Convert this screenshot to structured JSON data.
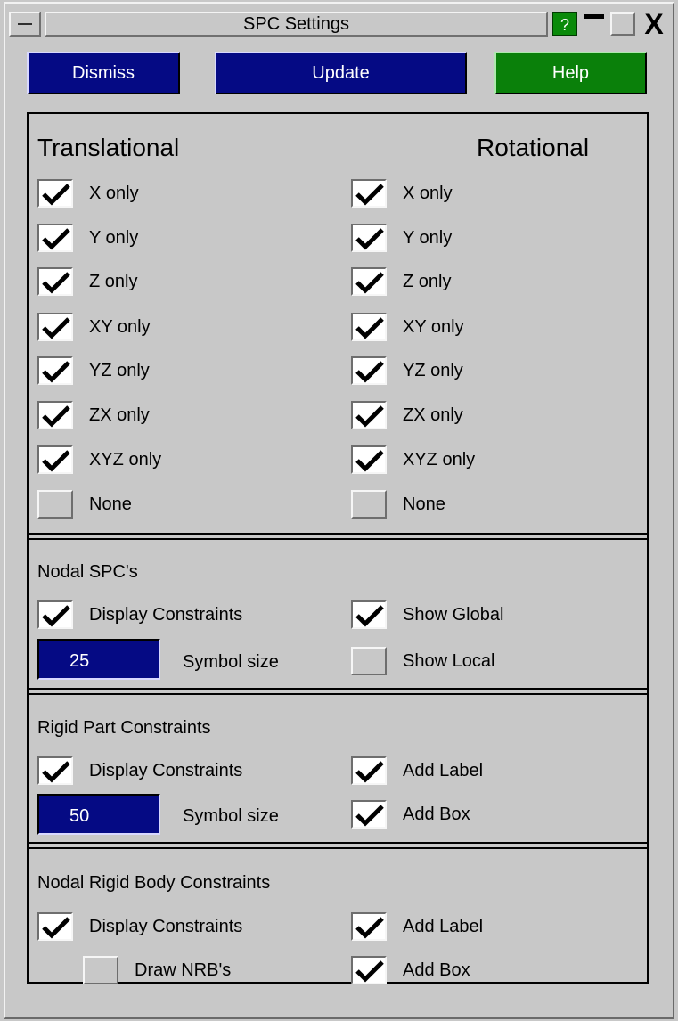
{
  "window": {
    "title": "SPC Settings",
    "help_glyph": "?",
    "close_glyph": "X"
  },
  "toolbar": {
    "dismiss_label": "Dismiss",
    "update_label": "Update",
    "help_label": "Help"
  },
  "colors": {
    "button_blue": "#050a84",
    "button_green": "#0a800a",
    "background": "#c8c8c8"
  },
  "dof": {
    "translational_heading": "Translational",
    "rotational_heading": "Rotational",
    "translational": [
      {
        "label": "X only",
        "checked": true
      },
      {
        "label": "Y only",
        "checked": true
      },
      {
        "label": "Z only",
        "checked": true
      },
      {
        "label": "XY only",
        "checked": true
      },
      {
        "label": "YZ only",
        "checked": true
      },
      {
        "label": "ZX only",
        "checked": true
      },
      {
        "label": "XYZ only",
        "checked": true
      },
      {
        "label": "None",
        "checked": false
      }
    ],
    "rotational": [
      {
        "label": "X only",
        "checked": true
      },
      {
        "label": "Y only",
        "checked": true
      },
      {
        "label": "Z only",
        "checked": true
      },
      {
        "label": "XY only",
        "checked": true
      },
      {
        "label": "YZ only",
        "checked": true
      },
      {
        "label": "ZX only",
        "checked": true
      },
      {
        "label": "XYZ only",
        "checked": true
      },
      {
        "label": "None",
        "checked": false
      }
    ]
  },
  "nodal_spc": {
    "title": "Nodal SPC's",
    "display_constraints": {
      "label": "Display Constraints",
      "checked": true
    },
    "show_global": {
      "label": "Show Global",
      "checked": true
    },
    "symbol_size_value": "25",
    "symbol_size_label": "Symbol size",
    "show_local": {
      "label": "Show Local",
      "checked": false
    }
  },
  "rigid_part": {
    "title": "Rigid Part Constraints",
    "display_constraints": {
      "label": "Display Constraints",
      "checked": true
    },
    "add_label": {
      "label": "Add Label",
      "checked": true
    },
    "symbol_size_value": "50",
    "symbol_size_label": "Symbol size",
    "add_box": {
      "label": "Add Box",
      "checked": true
    }
  },
  "nodal_rigid_body": {
    "title": "Nodal Rigid Body Constraints",
    "display_constraints": {
      "label": "Display Constraints",
      "checked": true
    },
    "add_label": {
      "label": "Add Label",
      "checked": true
    },
    "draw_nrb": {
      "label": "Draw NRB's",
      "checked": false
    },
    "add_box": {
      "label": "Add Box",
      "checked": true
    }
  }
}
